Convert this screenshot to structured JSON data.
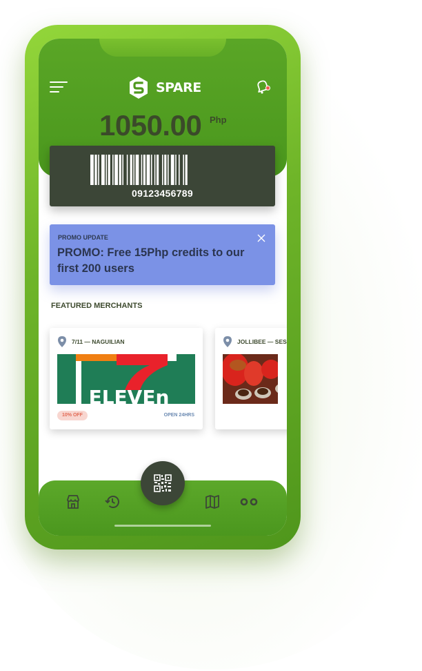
{
  "app": {
    "brand": "SPARE",
    "balance": "1050.00",
    "currency": "Php",
    "colors": {
      "brand_green": "#4f991f",
      "card_dark": "#3c4637",
      "promo_blue": "#7b92e6",
      "badge_red": "#e26a55"
    }
  },
  "account": {
    "barcode_number": "09123456789"
  },
  "promo": {
    "kicker": "PROMO UPDATE",
    "message": "PROMO: Free 15Php credits to our first 200 users"
  },
  "featured": {
    "title": "FEATURED MERCHANTS",
    "merchants": [
      {
        "name": "7/11 — NAGUILIAN",
        "badge": "10% OFF",
        "status": "OPEN 24HRS",
        "logo_text": "ELEVEn"
      },
      {
        "name": "JOLLIBEE — SESSION",
        "badge": "",
        "status": "",
        "logo_text": ""
      }
    ]
  },
  "nav": {
    "items": [
      "store-icon",
      "history-icon",
      "qr-code-icon",
      "map-icon",
      "more-icon"
    ]
  }
}
